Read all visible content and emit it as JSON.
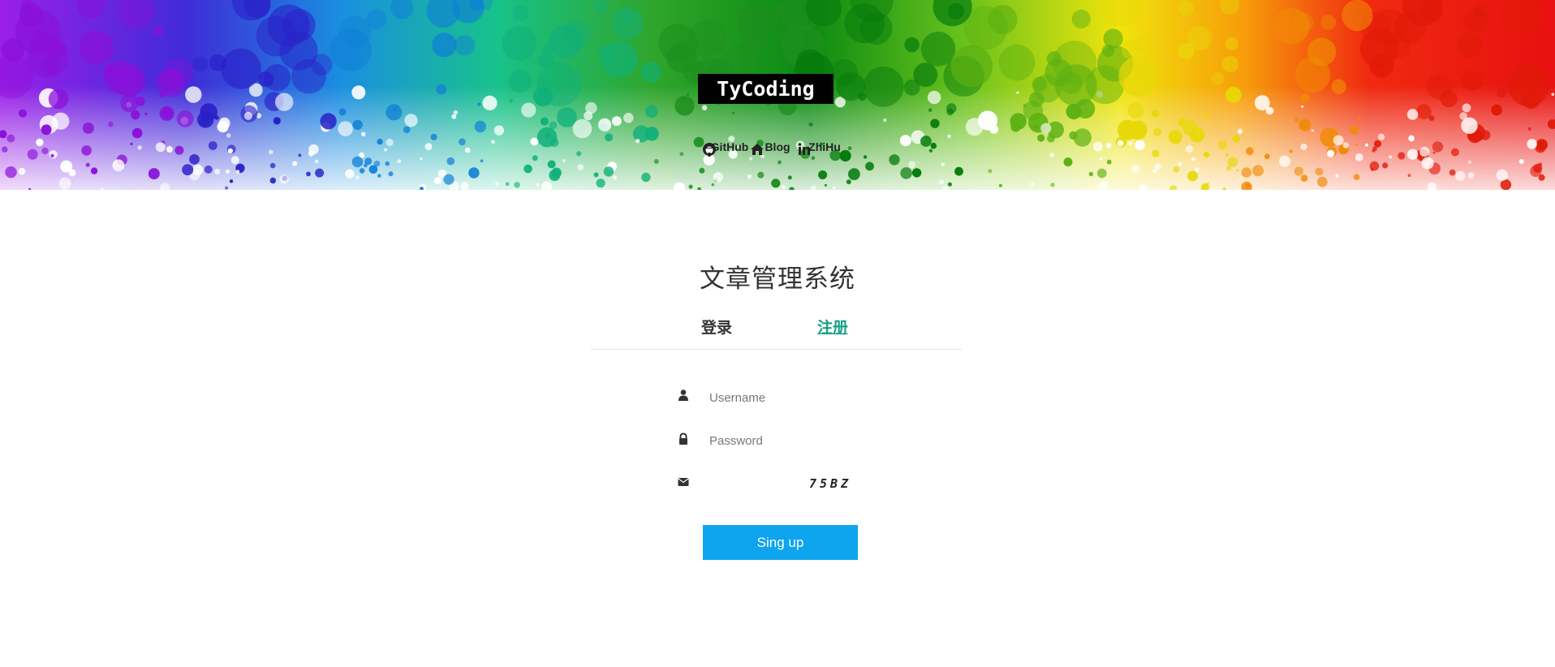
{
  "brand": "TyCoding",
  "social": [
    {
      "label": "GitHub",
      "icon": "github-icon"
    },
    {
      "label": "Blog",
      "icon": "home-icon"
    },
    {
      "label": "ZhiHu",
      "icon": "linkedin-icon"
    }
  ],
  "title": "文章管理系统",
  "tabs": {
    "login": "登录",
    "register": "注册"
  },
  "form": {
    "username_placeholder": "Username",
    "password_placeholder": "Password",
    "captcha_value": "",
    "captcha_text": "75BZ",
    "submit": "Sing up"
  },
  "colors": {
    "accent_tab": "#16a085",
    "button": "#0ea5ee",
    "brand_bg": "#000000"
  }
}
